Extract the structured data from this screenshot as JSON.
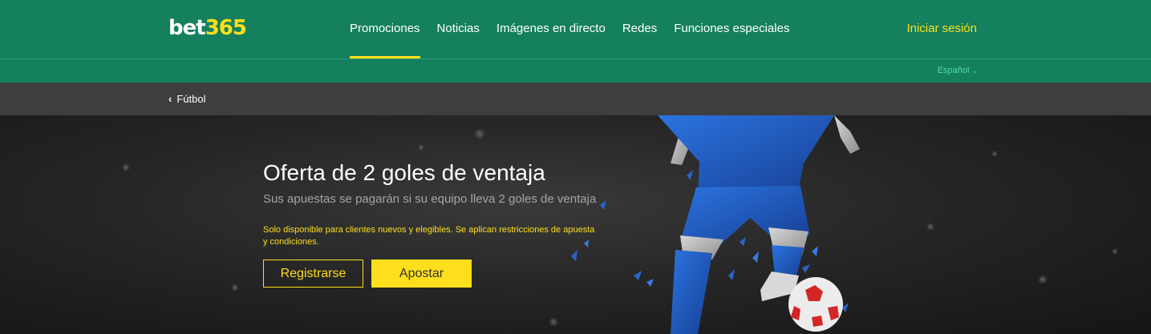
{
  "brand": {
    "logo_text": "bet",
    "logo_number": "365"
  },
  "nav": {
    "items": [
      {
        "label": "Promociones"
      },
      {
        "label": "Noticias"
      },
      {
        "label": "Imágenes en directo"
      },
      {
        "label": "Redes"
      },
      {
        "label": "Funciones especiales"
      }
    ],
    "active": "Promociones",
    "login_label": "Iniciar sesión"
  },
  "language": {
    "selected": "Español"
  },
  "breadcrumb": {
    "label": "Fútbol"
  },
  "hero": {
    "title": "Oferta de 2 goles de ventaja",
    "subtitle": "Sus apuestas se pagarán si su equipo lleva 2 goles de ventaja",
    "disclaimer": "Solo disponible para clientes nuevos y elegibles. Se aplican restricciones de apuesta y condiciones.",
    "register_label": "Registrarse",
    "bet_label": "Apostar"
  },
  "colors": {
    "brand_green": "#15805d",
    "accent_yellow": "#ffdf1b",
    "crumb_bar": "#3e3e3e",
    "kit_blue": "#1f5fc4"
  }
}
